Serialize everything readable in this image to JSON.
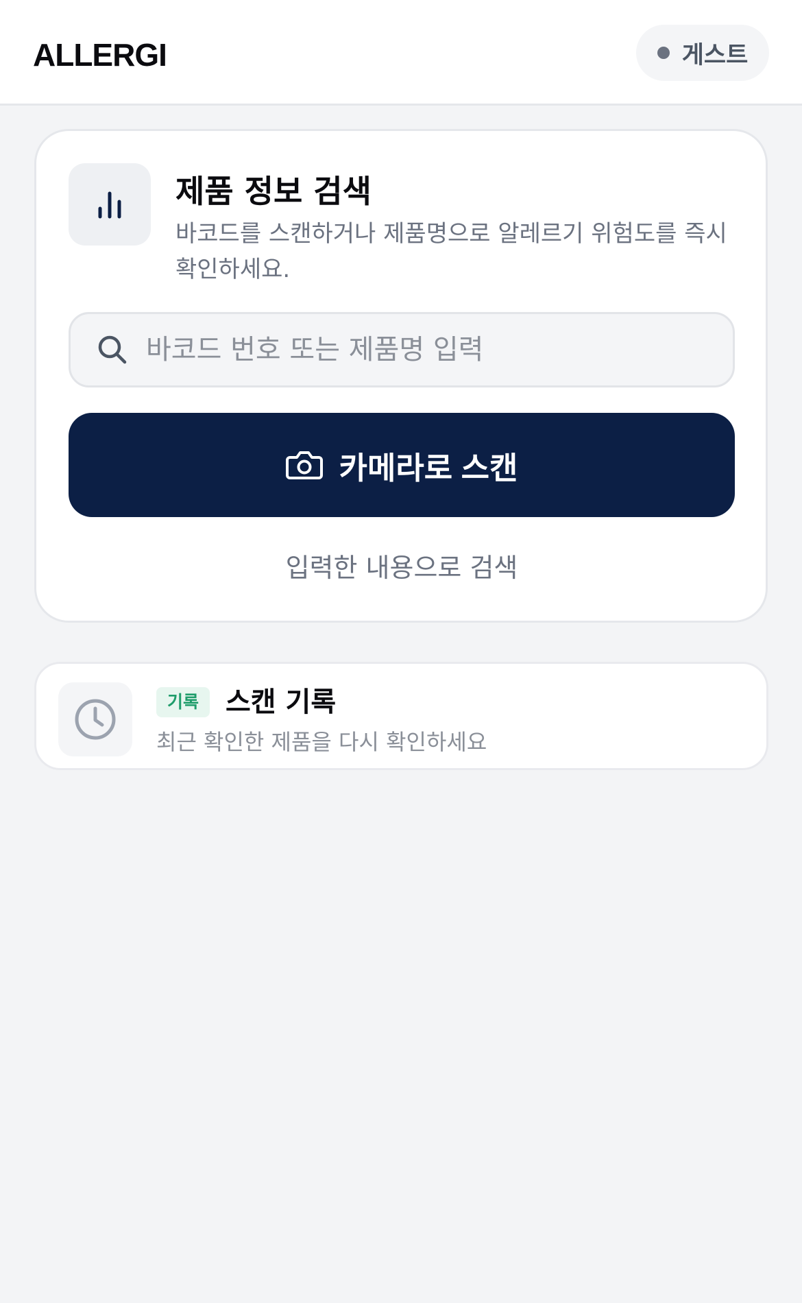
{
  "header": {
    "logo": "ALLERGI",
    "user_label": "게스트"
  },
  "search_card": {
    "icon": "bar-chart-icon",
    "title": "제품 정보 검색",
    "description": "바코드를 스캔하거나 제품명으로 알레르기 위험도를 즉시 확인하세요.",
    "search": {
      "icon": "search-icon",
      "placeholder": "바코드 번호 또는 제품명 입력",
      "value": ""
    },
    "scan_button": {
      "icon": "camera-icon",
      "label": "카메라로 스캔"
    },
    "text_search_label": "입력한 내용으로 검색"
  },
  "history_card": {
    "icon": "clock-icon",
    "badge": "기록",
    "title": "스캔 기록",
    "description": "최근 확인한 제품을 다시 확인하세요"
  },
  "colors": {
    "primary": "#0c1f45",
    "background": "#f3f4f6",
    "badge_bg": "#e7f6ef",
    "badge_text": "#1f9d6b",
    "muted_text": "#6b7280"
  }
}
